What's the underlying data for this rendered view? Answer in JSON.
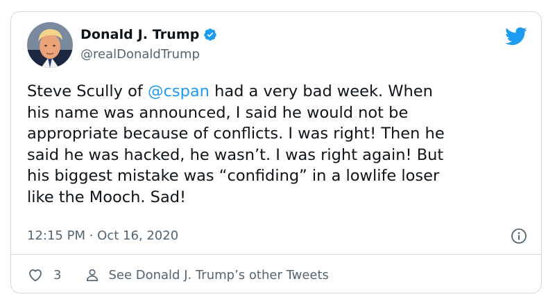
{
  "tweet": {
    "author_name": "Donald J. Trump",
    "author_handle": "@realDonaldTrump",
    "text_before": "Steve Scully of ",
    "mention": "@cspan",
    "text_after": " had a very bad week. When\nhis name was announced, I said he would not be\nappropriate because of conflicts. I was right! Then he\nsaid he was hacked, he wasn’t. I was right again! But\nhis biggest mistake was “confiding” in a lowlife loser\nlike the Mooch. Sad!",
    "timestamp": "12:15 PM · Oct 16, 2020",
    "like_count": "3",
    "see_other_label": "See Donald J. Trump’s other Tweets"
  },
  "icons": {
    "verified": "verified-badge-icon",
    "bird": "twitter-bird-icon",
    "info": "info-icon",
    "like": "heart-icon",
    "profile": "person-icon"
  },
  "colors": {
    "accent": "#1d9bf0",
    "text": "#0f1419",
    "secondary_text": "#536471",
    "border": "#cfd9de"
  }
}
